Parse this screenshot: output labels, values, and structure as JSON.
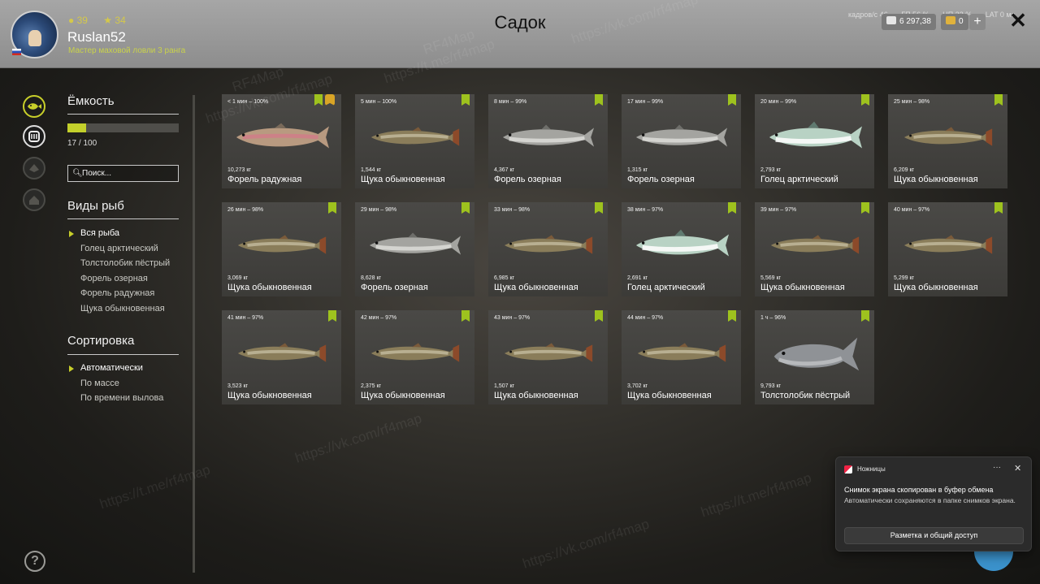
{
  "header": {
    "title": "Садок",
    "username": "Ruslan52",
    "rank": "Мастер маховой ловли 3 ранга",
    "coins_a": "39",
    "coins_b": "34",
    "hud_fps": "кадров/с 46",
    "hud_gp": "ГП 56 %",
    "hud_cp": "ЦП 32 %",
    "hud_lat": "LAT 0 мс",
    "silver": "6 297,38",
    "gold": "0",
    "plus_label": "+",
    "close_label": "✕"
  },
  "sidebar": {
    "capacity_title": "Ёмкость",
    "capacity_text": "17 / 100",
    "capacity_fraction": 0.17,
    "search_placeholder": "Поиск...",
    "species_title": "Виды рыб",
    "species": [
      {
        "label": "Вся рыба",
        "selected": true
      },
      {
        "label": "Голец арктический",
        "selected": false
      },
      {
        "label": "Толстолобик пёстрый",
        "selected": false
      },
      {
        "label": "Форель озерная",
        "selected": false
      },
      {
        "label": "Форель радужная",
        "selected": false
      },
      {
        "label": "Щука обыкновенная",
        "selected": false
      }
    ],
    "sort_title": "Сортировка",
    "sort": [
      {
        "label": "Автоматически",
        "selected": true
      },
      {
        "label": "По массе",
        "selected": false
      },
      {
        "label": "По времени вылова",
        "selected": false
      }
    ],
    "help_label": "?"
  },
  "fish": [
    {
      "stat": "< 1 мин – 100%",
      "mass": "10,273 кг",
      "name": "Форель радужная",
      "kind": "rainbow",
      "badges": [
        "green",
        "gold"
      ]
    },
    {
      "stat": "5 мин – 100%",
      "mass": "1,544 кг",
      "name": "Щука обыкновенная",
      "kind": "pike",
      "badges": [
        "green"
      ]
    },
    {
      "stat": "8 мин – 99%",
      "mass": "4,367 кг",
      "name": "Форель озерная",
      "kind": "lake",
      "badges": [
        "green"
      ]
    },
    {
      "stat": "17 мин – 99%",
      "mass": "1,315 кг",
      "name": "Форель озерная",
      "kind": "lake",
      "badges": [
        "green"
      ]
    },
    {
      "stat": "20 мин – 99%",
      "mass": "2,793 кг",
      "name": "Голец арктический",
      "kind": "char",
      "badges": [
        "green"
      ]
    },
    {
      "stat": "25 мин – 98%",
      "mass": "6,209 кг",
      "name": "Щука обыкновенная",
      "kind": "pike",
      "badges": [
        "green"
      ]
    },
    {
      "stat": "26 мин – 98%",
      "mass": "3,069 кг",
      "name": "Щука обыкновенная",
      "kind": "pike",
      "badges": [
        "green"
      ]
    },
    {
      "stat": "29 мин – 98%",
      "mass": "8,628 кг",
      "name": "Форель озерная",
      "kind": "lake",
      "badges": [
        "green"
      ]
    },
    {
      "stat": "33 мин – 98%",
      "mass": "6,985 кг",
      "name": "Щука обыкновенная",
      "kind": "pike",
      "badges": [
        "green"
      ]
    },
    {
      "stat": "38 мин – 97%",
      "mass": "2,691 кг",
      "name": "Голец арктический",
      "kind": "char",
      "badges": [
        "green"
      ]
    },
    {
      "stat": "39 мин – 97%",
      "mass": "5,569 кг",
      "name": "Щука обыкновенная",
      "kind": "pike",
      "badges": [
        "green"
      ]
    },
    {
      "stat": "40 мин – 97%",
      "mass": "5,299 кг",
      "name": "Щука обыкновенная",
      "kind": "pike",
      "badges": [
        "green"
      ]
    },
    {
      "stat": "41 мин – 97%",
      "mass": "3,523 кг",
      "name": "Щука обыкновенная",
      "kind": "pike",
      "badges": [
        "green"
      ]
    },
    {
      "stat": "42 мин – 97%",
      "mass": "2,375 кг",
      "name": "Щука обыкновенная",
      "kind": "pike",
      "badges": [
        "green"
      ]
    },
    {
      "stat": "43 мин – 97%",
      "mass": "1,507 кг",
      "name": "Щука обыкновенная",
      "kind": "pike",
      "badges": [
        "green"
      ]
    },
    {
      "stat": "44 мин – 97%",
      "mass": "3,702 кг",
      "name": "Щука обыкновенная",
      "kind": "pike",
      "badges": [
        "green"
      ]
    },
    {
      "stat": "1 ч – 96%",
      "mass": "9,793 кг",
      "name": "Толстолобик пёстрый",
      "kind": "carp",
      "badges": [
        "green"
      ]
    }
  ],
  "watermarks": [
    "RF4Map",
    "https://vk.com/rf4map",
    "https://t.me/rf4map"
  ],
  "toast": {
    "app": "Ножницы",
    "more": "···",
    "close": "✕",
    "title": "Снимок экрана скопирован в буфер обмена",
    "body": "Автоматически сохраняются в папке снимков экрана.",
    "button": "Разметка и общий доступ"
  },
  "colors": {
    "accent": "#c3d02b",
    "badge_green": "#9ec21e",
    "badge_gold": "#d9a526"
  },
  "icons": {
    "nav": [
      "fish-icon",
      "keepnet-icon",
      "boat-icon",
      "home-icon"
    ]
  }
}
